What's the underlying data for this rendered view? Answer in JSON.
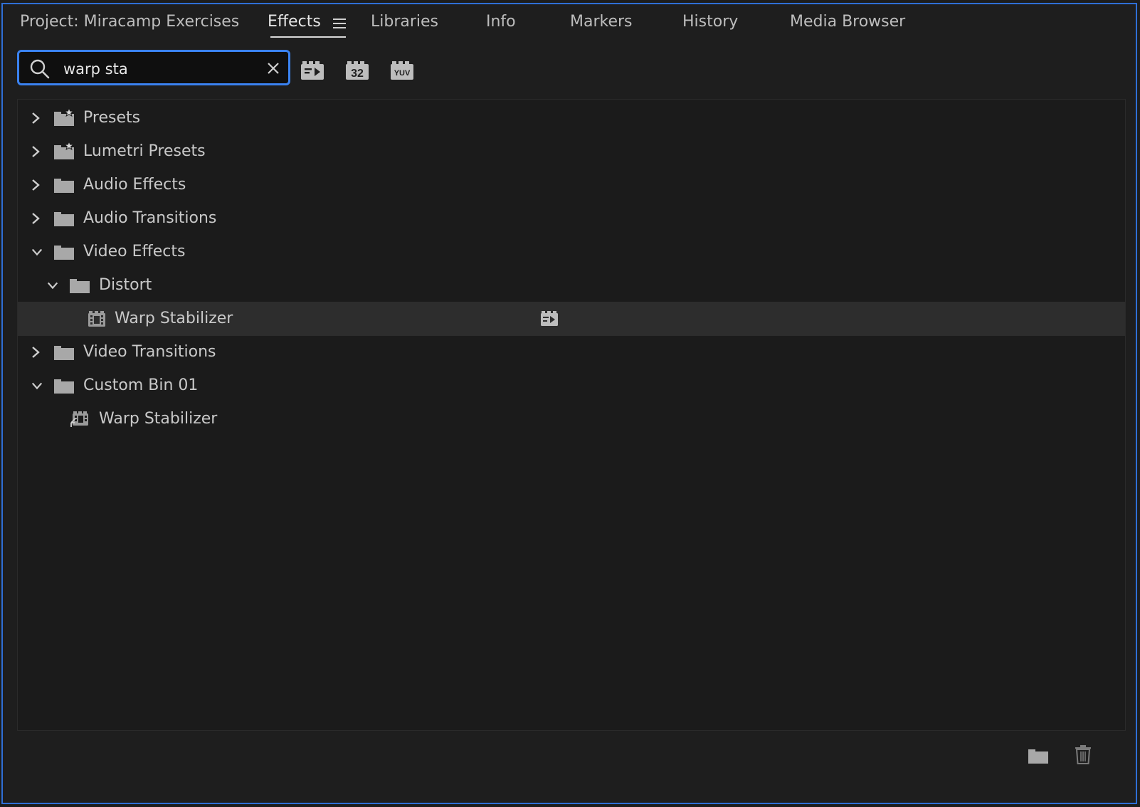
{
  "tabs": {
    "project": "Project: Miracamp Exercises",
    "effects": "Effects",
    "libraries": "Libraries",
    "info": "Info",
    "markers": "Markers",
    "history": "History",
    "media_browser": "Media Browser"
  },
  "search": {
    "value": "warp sta"
  },
  "filters": {
    "yuv_label": "YUV",
    "float_label": "32"
  },
  "tree": {
    "presets": "Presets",
    "lumetri_presets": "Lumetri Presets",
    "audio_effects": "Audio Effects",
    "audio_transitions": "Audio Transitions",
    "video_effects": "Video Effects",
    "distort": "Distort",
    "warp_stabilizer": "Warp Stabilizer",
    "video_transitions": "Video Transitions",
    "custom_bin": "Custom Bin 01",
    "custom_warp_stabilizer": "Warp Stabilizer"
  },
  "colors": {
    "accent": "#3a82f0",
    "background": "#1e1e1e",
    "selected_row": "#2d2d2d"
  }
}
